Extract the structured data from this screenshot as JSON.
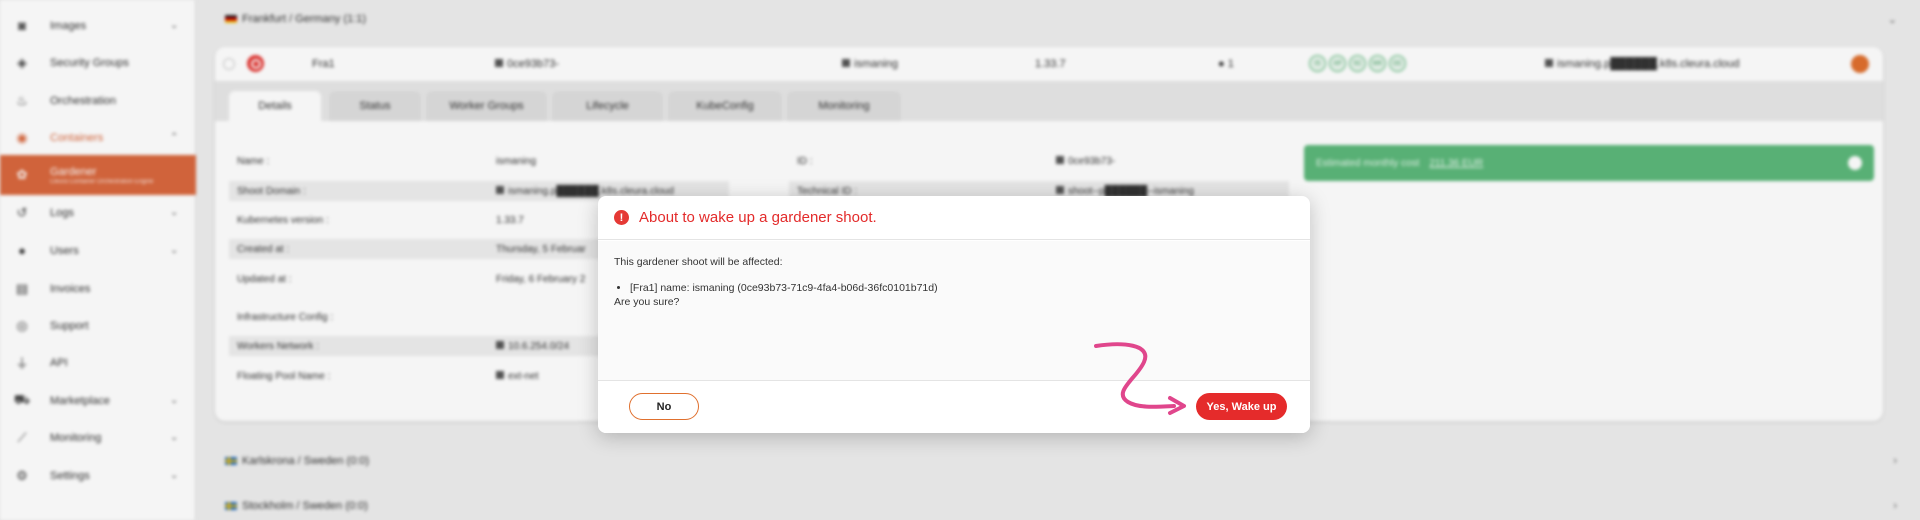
{
  "sidebar": {
    "items": [
      {
        "label": "Images",
        "icon": "camera-icon",
        "glyph": "◙"
      },
      {
        "label": "Security Groups",
        "icon": "shield-icon",
        "glyph": "◈"
      },
      {
        "label": "Orchestration",
        "icon": "orchestration-icon",
        "glyph": "♨"
      },
      {
        "label": "Containers",
        "icon": "containers-icon",
        "glyph": "◉"
      },
      {
        "label": "Gardener",
        "sub": "Cleura Container Orchestration Engine",
        "icon": "gardener-icon",
        "glyph": "✿"
      },
      {
        "label": "Logs",
        "icon": "history-icon",
        "glyph": "↺"
      },
      {
        "label": "Users",
        "icon": "user-icon",
        "glyph": "●"
      },
      {
        "label": "Invoices",
        "icon": "invoice-icon",
        "glyph": "▤"
      },
      {
        "label": "Support",
        "icon": "lifebuoy-icon",
        "glyph": "◎"
      },
      {
        "label": "API",
        "icon": "plug-icon",
        "glyph": "⏚"
      },
      {
        "label": "Marketplace",
        "icon": "cart-icon",
        "glyph": "⛟"
      },
      {
        "label": "Monitoring",
        "icon": "chart-icon",
        "glyph": "⟋"
      },
      {
        "label": "Settings",
        "icon": "gear-icon",
        "glyph": "⚙"
      }
    ]
  },
  "regions": {
    "frankfurt": "Frankfurt / Germany (1:1)",
    "karlskrona": "Karlskrona / Sweden (0:0)",
    "stockholm": "Stockholm / Sweden (0:0)"
  },
  "shoot": {
    "region": "Fra1",
    "uid": "0ce93b73-",
    "name": "ismaning",
    "version": "1.33.7",
    "workers": "1",
    "status_icons": [
      "IS",
      "AP",
      "SC",
      "WK",
      "OC"
    ],
    "domain": "ismaning.p██████.k8s.cleura.cloud"
  },
  "tabs": [
    "Details",
    "Status",
    "Worker Groups",
    "Lifecycle",
    "KubeConfig",
    "Monitoring"
  ],
  "details": {
    "left": [
      {
        "label": "Name :",
        "value": "ismaning"
      },
      {
        "label": "Shoot Domain :",
        "value": "ismaning.p██████.k8s.cleura.cloud"
      },
      {
        "label": "Kubernetes version :",
        "value": "1.33.7"
      },
      {
        "label": "Created at :",
        "value": "Thursday, 5 Februar"
      },
      {
        "label": "Updated at :",
        "value": "Friday, 6 February 2"
      },
      {
        "label": "Infrastructure Config :",
        "value": ""
      },
      {
        "label": "Workers Network :",
        "value": "10.6.254.0/24"
      },
      {
        "label": "Floating Pool Name :",
        "value": "ext-net"
      }
    ],
    "right": [
      {
        "label": "ID :",
        "value": "0ce93b73-"
      },
      {
        "label": "Technical ID :",
        "value": "shoot--p██████--ismaning"
      }
    ],
    "cost_label": "Estimated monthly cost",
    "cost_value": "211.36 EUR"
  },
  "modal": {
    "title": "About to wake up a gardener shoot.",
    "intro": "This gardener shoot will be affected:",
    "item": "[Fra1] name: ismaning (0ce93b73-71c9-4fa4-b06d-36fc0101b71d)",
    "question": "Are you sure?",
    "no_label": "No",
    "yes_label": "Yes, Wake up",
    "warn_glyph": "!"
  },
  "colors": {
    "accent": "#d9683e",
    "danger": "#e52b2b",
    "success": "#5cb87a",
    "annotation": "#e0468c"
  }
}
